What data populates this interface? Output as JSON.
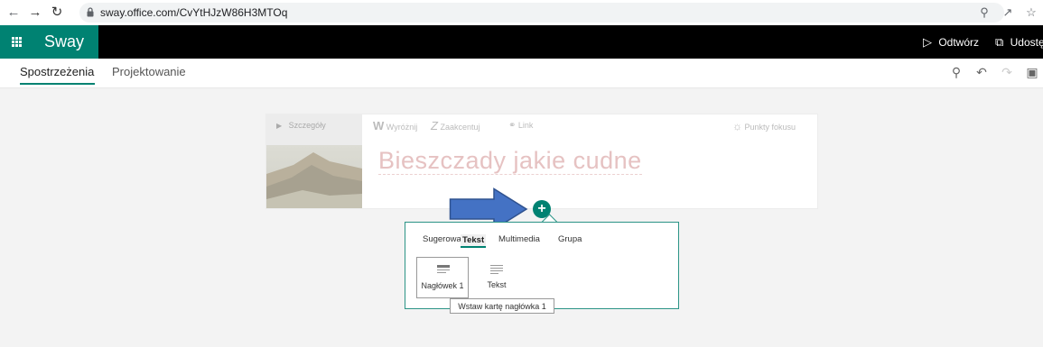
{
  "browser": {
    "url": "sway.office.com/CvYtHJzW86H3MTOq",
    "icons": [
      "back-icon",
      "forward-icon",
      "reload-icon",
      "lock-icon",
      "zoom-icon",
      "share-icon",
      "star-icon"
    ]
  },
  "appbar": {
    "brand": "Sway",
    "play_label": "Odtwórz",
    "share_label": "Udostę",
    "accent": "#008272"
  },
  "tabs": {
    "insights": "Spostrzeżenia",
    "design": "Projektowanie"
  },
  "card": {
    "details_label": "Szczegóły",
    "toolbar": {
      "emphasize": "Wyróżnij",
      "accent": "Zaakcentuj",
      "link": "Link",
      "focus_points": "Punkty fokusu"
    },
    "title": "Bieszczady jakie cudne"
  },
  "insert_panel": {
    "tabs": [
      "Sugerowane",
      "Tekst",
      "Multimedia",
      "Grupa"
    ],
    "selected_tab": "Tekst",
    "tiles": [
      {
        "label": "Nagłówek 1",
        "icon": "heading-icon"
      },
      {
        "label": "Tekst",
        "icon": "text-icon"
      }
    ],
    "tooltip": "Wstaw kartę nagłówka 1"
  }
}
